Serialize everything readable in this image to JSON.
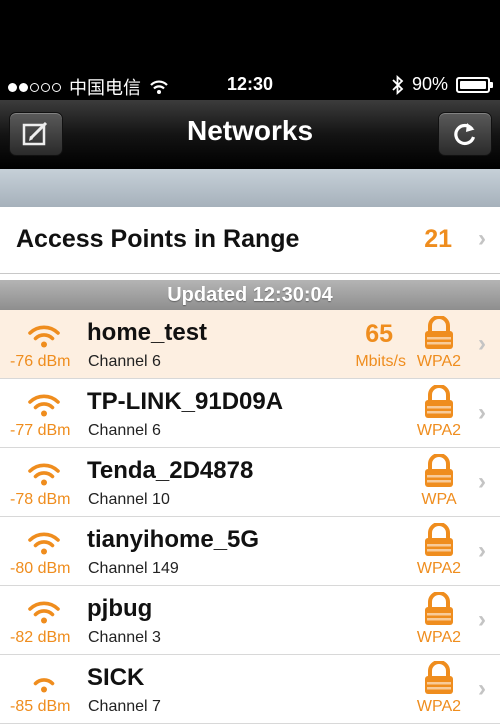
{
  "status_bar": {
    "carrier": "中国电信",
    "time": "12:30",
    "battery": "90%"
  },
  "nav": {
    "title": "Networks",
    "left_button": "edit-icon",
    "right_button": "refresh-icon"
  },
  "summary": {
    "label": "Access Points in Range",
    "count": "21"
  },
  "updated": "Updated 12:30:04",
  "accent": "#ef8d1e",
  "networks": [
    {
      "ssid": "home_test",
      "dbm": "-76 dBm",
      "channel": "Channel 6",
      "speed": "65",
      "unit": "Mbits/s",
      "security": "WPA2"
    },
    {
      "ssid": "TP-LINK_91D09A",
      "dbm": "-77 dBm",
      "channel": "Channel 6",
      "security": "WPA2"
    },
    {
      "ssid": "Tenda_2D4878",
      "dbm": "-78 dBm",
      "channel": "Channel 10",
      "security": "WPA"
    },
    {
      "ssid": "tianyihome_5G",
      "dbm": "-80 dBm",
      "channel": "Channel 149",
      "security": "WPA2"
    },
    {
      "ssid": "pjbug",
      "dbm": "-82 dBm",
      "channel": "Channel 3",
      "security": "WPA2"
    },
    {
      "ssid": "SICK",
      "dbm": "-85 dBm",
      "channel": "Channel 7",
      "security": "WPA2"
    }
  ]
}
